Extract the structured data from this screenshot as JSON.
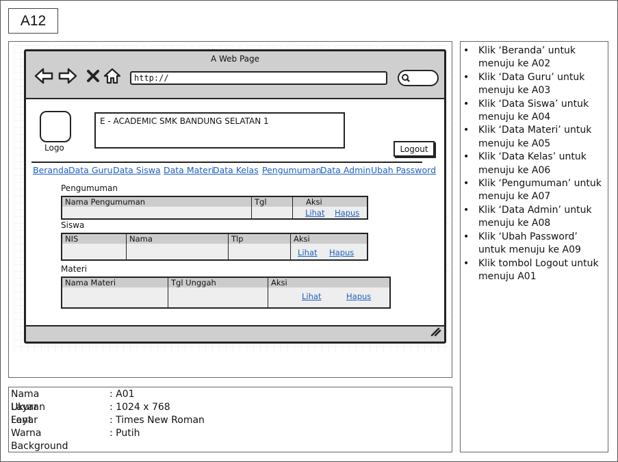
{
  "page_id": "A12",
  "browser": {
    "title": "A Web Page",
    "url": "http://"
  },
  "header": {
    "logo_label": "Logo",
    "app_title": "E - ACADEMIC SMK BANDUNG SELATAN 1",
    "logout_label": "Logout"
  },
  "menu": [
    {
      "label": "Beranda"
    },
    {
      "label": "Data Guru"
    },
    {
      "label": "Data Siswa"
    },
    {
      "label": "Data Materi"
    },
    {
      "label": "Data Kelas"
    },
    {
      "label": "Pengumuman"
    },
    {
      "label": "Data Admin"
    },
    {
      "label": "Ubah Password"
    }
  ],
  "sections": {
    "pengumuman": {
      "title": "Pengumuman",
      "columns": [
        "Nama Pengumuman",
        "Tgl",
        "Aksi"
      ],
      "actions": [
        "Lihat",
        "Hapus"
      ]
    },
    "siswa": {
      "title": "Siswa",
      "columns": [
        "NIS",
        "Nama",
        "Tlp",
        "Aksi"
      ],
      "actions": [
        "Lihat",
        "Hapus"
      ]
    },
    "materi": {
      "title": "Materi",
      "columns": [
        "Nama Materi",
        "Tgl Unggah",
        "Aksi"
      ],
      "actions": [
        "Lihat",
        "Hapus"
      ]
    }
  },
  "info": [
    {
      "key": "Nama Layar",
      "value": ": A01"
    },
    {
      "key": "Ukuran Layar",
      "value": ": 1024 x 768"
    },
    {
      "key": "Font",
      "value": ": Times New Roman"
    },
    {
      "key": "Warna Background",
      "value": ": Putih"
    }
  ],
  "notes": [
    "Klik ‘Beranda’ untuk menuju ke A02",
    "Klik ‘Data Guru’ untuk menuju ke A03",
    "Klik ‘Data Siswa’ untuk menuju ke A04",
    "Klik ‘Data Materi’ untuk menuju ke A05",
    "Klik ‘Data Kelas’ untuk menuju ke A06",
    "Klik ‘Pengumuman’ untuk menuju ke A07",
    "Klik ‘Data Admin’ untuk menuju ke A08",
    "Klik ‘Ubah Password’ untuk menuju ke A09",
    "Klik tombol Logout untuk menuju A01"
  ],
  "colors": {
    "link": "#1f5fbf",
    "toolbar": "#cfcfcf",
    "table_header": "#cccccc",
    "table_body": "#eeeeee"
  }
}
